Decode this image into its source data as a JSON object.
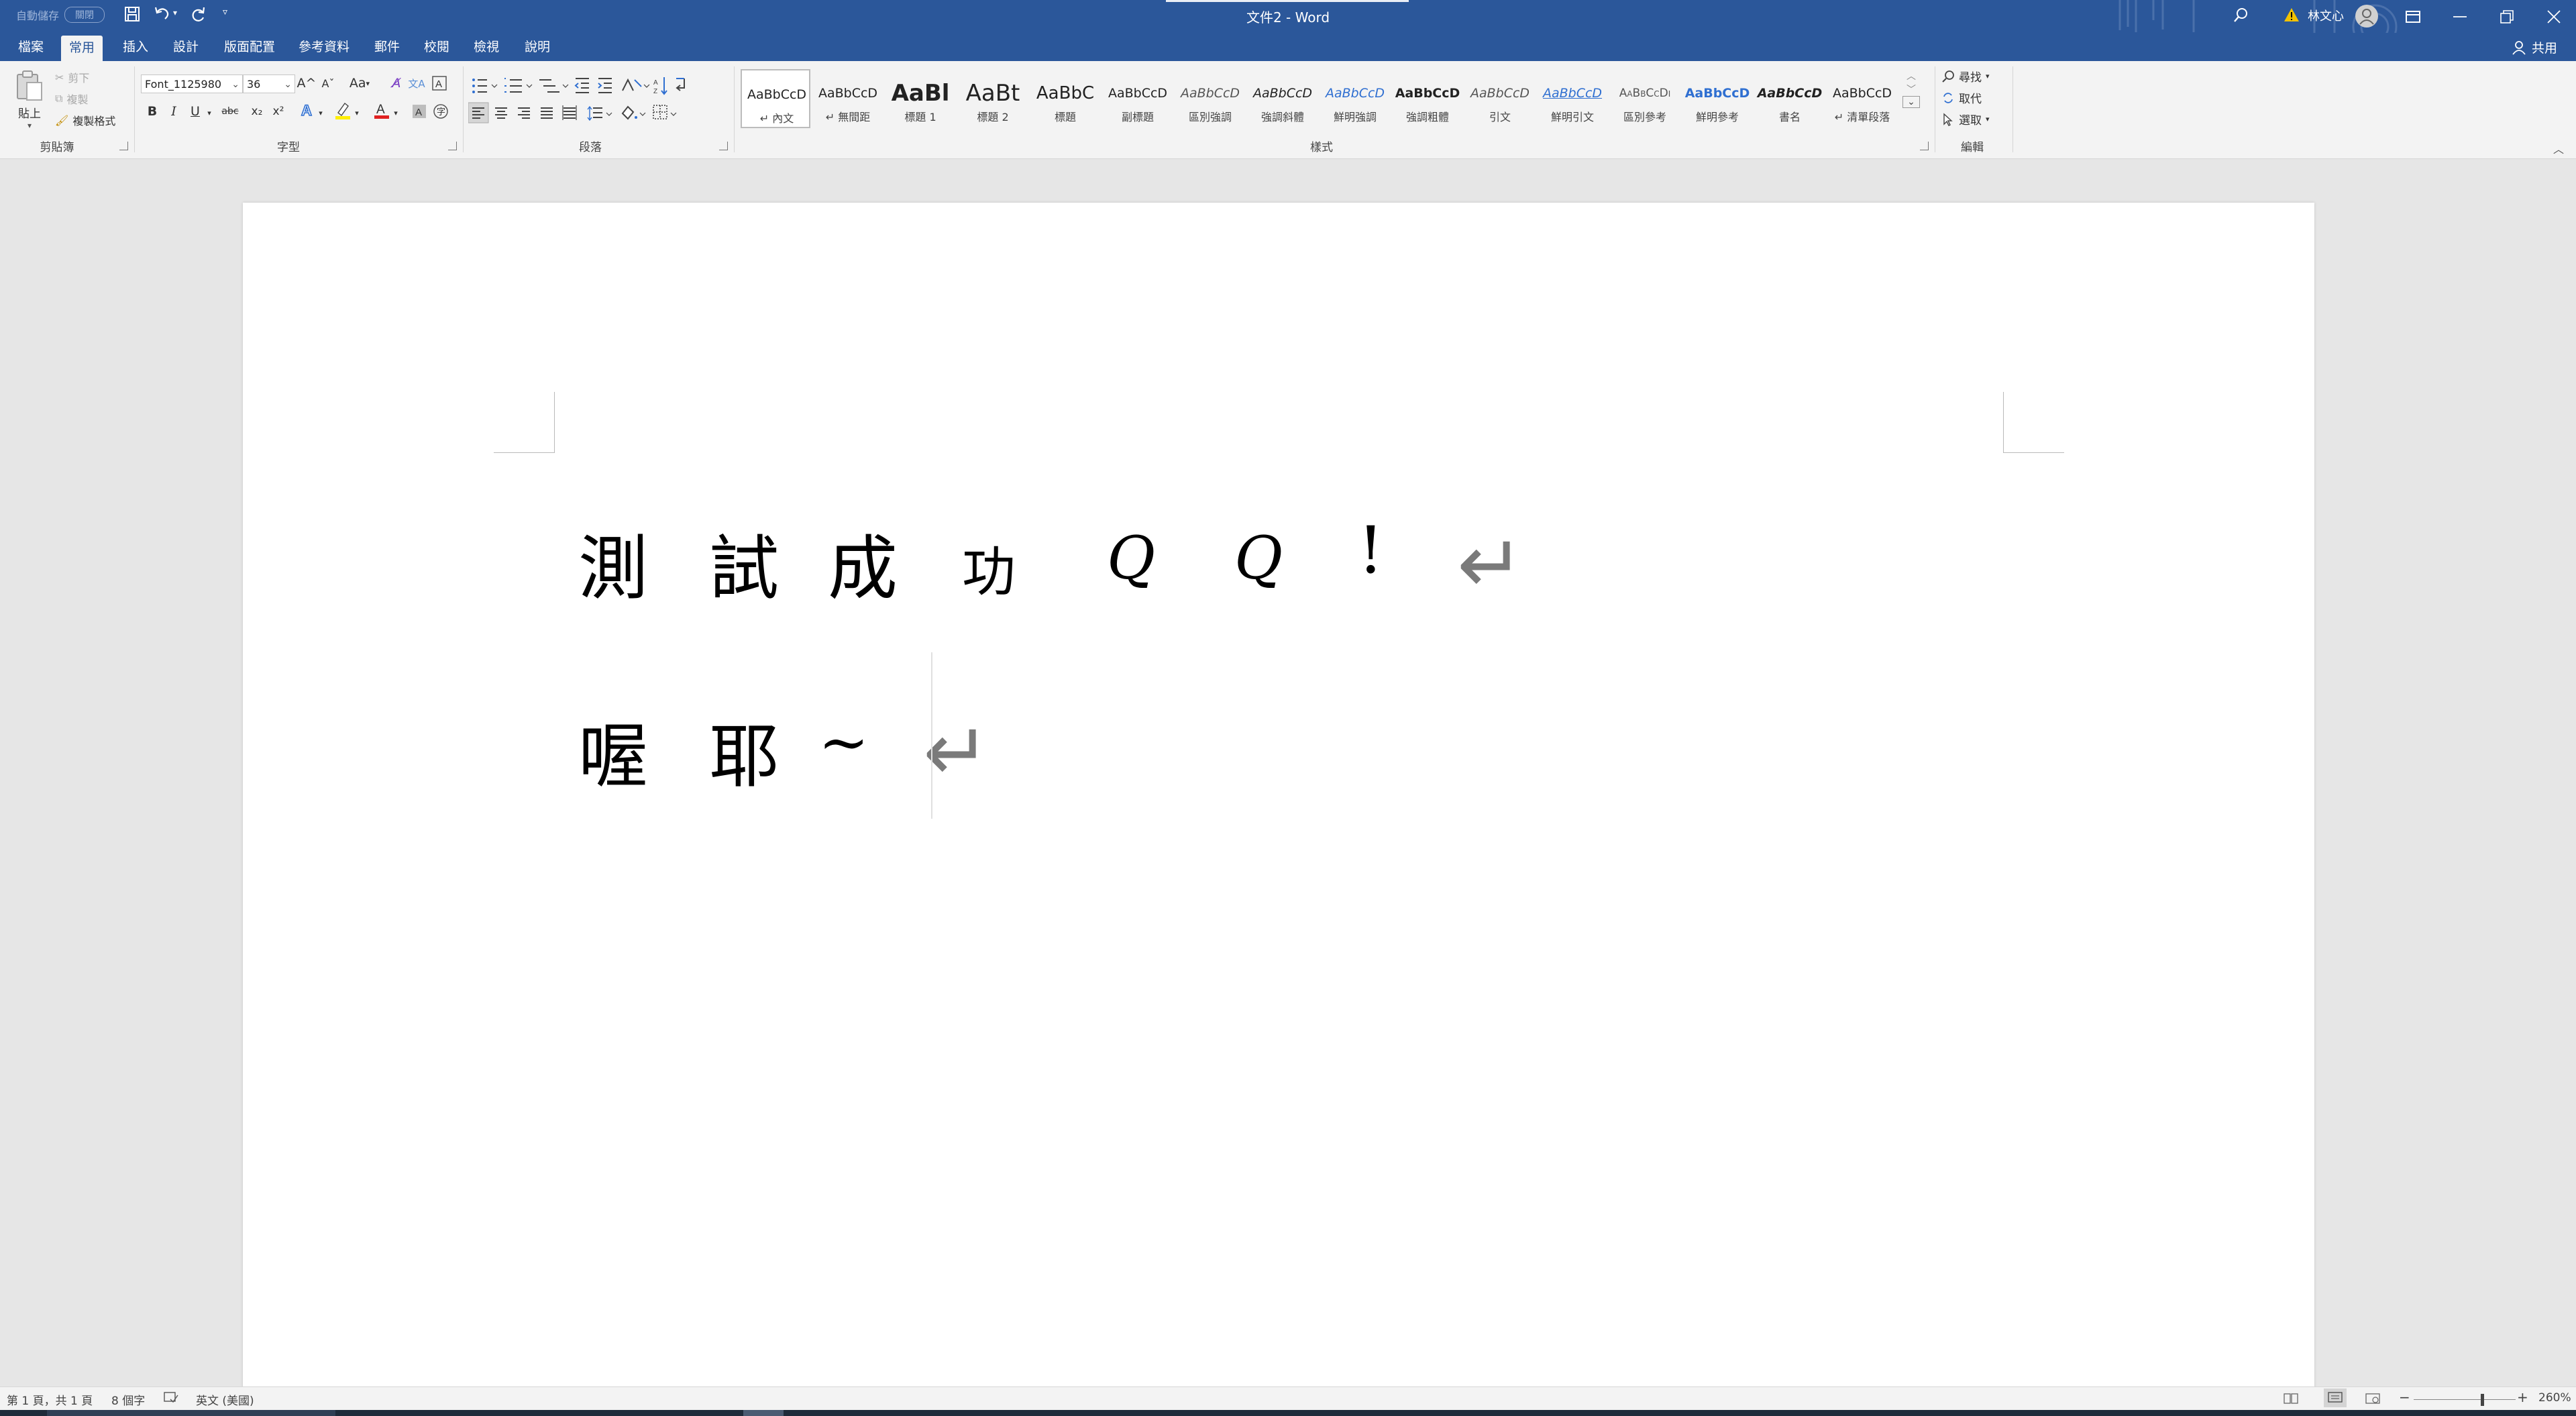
{
  "titlebar": {
    "autosave_label": "自動儲存",
    "autosave_state": "關閉",
    "doc_title": "文件2  -  Word",
    "user_name": "林文心"
  },
  "tabs": [
    {
      "label": "檔案"
    },
    {
      "label": "常用",
      "active": true
    },
    {
      "label": "插入"
    },
    {
      "label": "設計"
    },
    {
      "label": "版面配置"
    },
    {
      "label": "參考資料"
    },
    {
      "label": "郵件"
    },
    {
      "label": "校閱"
    },
    {
      "label": "檢視"
    },
    {
      "label": "說明"
    }
  ],
  "share_label": "共用",
  "clipboard": {
    "paste": "貼上",
    "cut": "剪下",
    "copy": "複製",
    "format_painter": "複製格式",
    "group_label": "剪貼簿"
  },
  "font": {
    "name": "Font_1125980",
    "size": "36",
    "group_label": "字型",
    "bold": "B",
    "italic": "I",
    "underline": "U",
    "strike": "abc",
    "subscript": "x₂",
    "superscript": "x²",
    "grow": "A^",
    "shrink": "Aˇ",
    "change_case": "Aa",
    "font_color_accent": "#e02020",
    "highlight_accent": "#ffee00"
  },
  "paragraph": {
    "group_label": "段落"
  },
  "styles": {
    "group_label": "樣式",
    "items": [
      {
        "preview": "AaBbCcD",
        "name": "↵ 內文"
      },
      {
        "preview": "AaBbCcD",
        "name": "↵ 無間距"
      },
      {
        "preview": "AaBl",
        "name": "標題 1"
      },
      {
        "preview": "AaBt",
        "name": "標題 2"
      },
      {
        "preview": "AaBbC",
        "name": "標題"
      },
      {
        "preview": "AaBbCcD",
        "name": "副標題"
      },
      {
        "preview": "AaBbCcD",
        "name": "區別強調"
      },
      {
        "preview": "AaBbCcD",
        "name": "強調斜體"
      },
      {
        "preview": "AaBbCcD",
        "name": "鮮明強調"
      },
      {
        "preview": "AaBbCcD",
        "name": "強調粗體"
      },
      {
        "preview": "AaBbCcD",
        "name": "引文"
      },
      {
        "preview": "AaBbCcD",
        "name": "鮮明引文"
      },
      {
        "preview": "AaBbCcDı",
        "name": "區別參考"
      },
      {
        "preview": "AaBbCcD",
        "name": "鮮明參考"
      },
      {
        "preview": "AaBbCcD",
        "name": "書名"
      },
      {
        "preview": "AaBbCcD",
        "name": "↵ 清單段落"
      }
    ]
  },
  "editing": {
    "find": "尋找",
    "replace": "取代",
    "select": "選取",
    "group_label": "編輯"
  },
  "document": {
    "line1": [
      "測",
      "試",
      "成",
      "功",
      "Q",
      "Q",
      "!"
    ],
    "line2": [
      "喔",
      "耶",
      "~"
    ],
    "para_mark": "↵"
  },
  "status": {
    "page": "第 1 頁，共 1 頁",
    "words": "8 個字",
    "language": "英文 (美國)",
    "zoom": "260%"
  }
}
